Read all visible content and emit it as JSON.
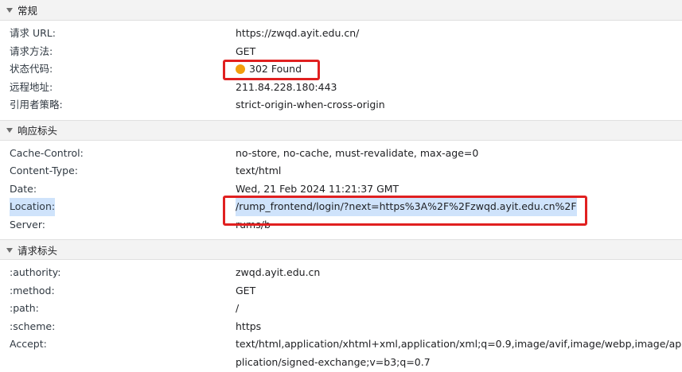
{
  "general": {
    "header": "常规",
    "rows": [
      {
        "key": "请求 URL:",
        "value": "https://zwqd.ayit.edu.cn/"
      },
      {
        "key": "请求方法:",
        "value": "GET"
      },
      {
        "key": "状态代码:",
        "value": "302 Found",
        "status_color": "#f29e0c"
      },
      {
        "key": "远程地址:",
        "value": "211.84.228.180:443"
      },
      {
        "key": "引用者策略:",
        "value": "strict-origin-when-cross-origin"
      }
    ]
  },
  "response_headers": {
    "header": "响应标头",
    "rows": [
      {
        "key": "Cache-Control:",
        "value": "no-store, no-cache, must-revalidate, max-age=0"
      },
      {
        "key": "Content-Type:",
        "value": "text/html"
      },
      {
        "key": "Date:",
        "value": "Wed, 21 Feb 2024 11:21:37 GMT"
      },
      {
        "key": "Location:",
        "value": "/rump_frontend/login/?next=https%3A%2F%2Fzwqd.ayit.edu.cn%2F"
      },
      {
        "key": "Server:",
        "value": "rums/b"
      }
    ]
  },
  "request_headers": {
    "header": "请求标头",
    "rows": [
      {
        "key": ":authority:",
        "value": "zwqd.ayit.edu.cn"
      },
      {
        "key": ":method:",
        "value": "GET"
      },
      {
        "key": ":path:",
        "value": "/"
      },
      {
        "key": ":scheme:",
        "value": "https"
      },
      {
        "key": "Accept:",
        "value": "text/html,application/xhtml+xml,application/xml;q=0.9,image/avif,image/webp,image/apng,*/*"
      },
      {
        "key": "",
        "value": "plication/signed-exchange;v=b3;q=0.7"
      }
    ]
  },
  "colors": {
    "highlight_box": "#e02020",
    "selection": "#cfe3fb",
    "section_bg": "#f3f3f3"
  }
}
